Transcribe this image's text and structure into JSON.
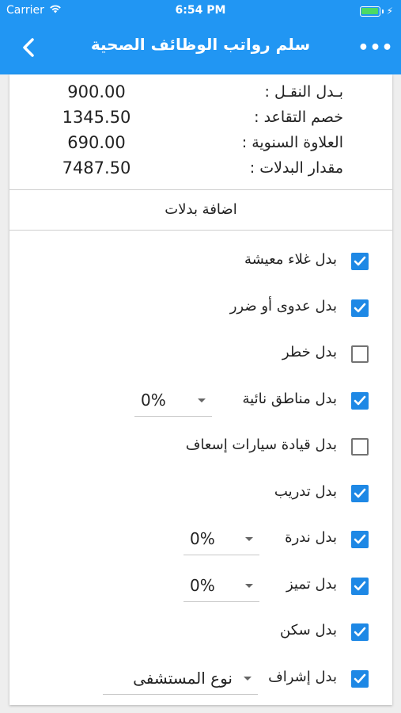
{
  "status_bar": {
    "carrier": "Carrier",
    "time": "6:54 PM"
  },
  "toolbar": {
    "title": "سلم رواتب الوظائف الصحية",
    "more_label": "•••"
  },
  "summary": [
    {
      "label": "بـدل النقـل :",
      "value": "900.00"
    },
    {
      "label": "خصم التقاعد :",
      "value": "1345.50"
    },
    {
      "label": "العلاوة السنوية :",
      "value": "690.00"
    },
    {
      "label": "مقدار البدلات :",
      "value": "7487.50"
    }
  ],
  "section_title": "اضافة بدلات",
  "allowances": [
    {
      "label": "بدل غلاء معيشة",
      "checked": true
    },
    {
      "label": "بدل عدوى أو ضرر",
      "checked": true
    },
    {
      "label": "بدل خطر",
      "checked": false
    },
    {
      "label": "بدل مناطق نائية",
      "checked": true,
      "dropdown": "0%"
    },
    {
      "label": "بدل قيادة سيارات إسعاف",
      "checked": false
    },
    {
      "label": "بدل تدريب",
      "checked": true
    },
    {
      "label": "بدل ندرة",
      "checked": true,
      "dropdown": "0%"
    },
    {
      "label": "بدل تميز",
      "checked": true,
      "dropdown": "0%"
    },
    {
      "label": "بدل سكن",
      "checked": true
    },
    {
      "label": "بدل إشراف",
      "checked": true,
      "dropdown": "نوع المستشفى"
    }
  ],
  "colors": {
    "app_bar": "#2196f3",
    "checkbox_checked": "#1e88e5",
    "battery": "#4cd964"
  }
}
